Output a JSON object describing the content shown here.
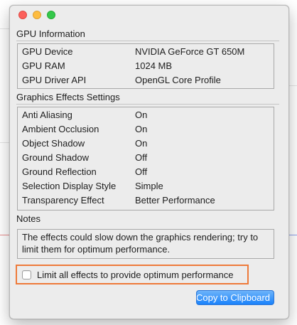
{
  "gpu_information": {
    "title": "GPU Information",
    "rows": [
      {
        "label": "GPU Device",
        "value": "NVIDIA GeForce GT 650M"
      },
      {
        "label": "GPU RAM",
        "value": "1024 MB"
      },
      {
        "label": "GPU Driver API",
        "value": "OpenGL Core Profile"
      }
    ]
  },
  "graphics_effects": {
    "title": "Graphics Effects Settings",
    "rows": [
      {
        "label": "Anti Aliasing",
        "value": "On"
      },
      {
        "label": "Ambient Occlusion",
        "value": "On"
      },
      {
        "label": "Object Shadow",
        "value": "On"
      },
      {
        "label": "Ground Shadow",
        "value": "Off"
      },
      {
        "label": "Ground Reflection",
        "value": "Off"
      },
      {
        "label": "Selection Display Style",
        "value": "Simple"
      },
      {
        "label": "Transparency Effect",
        "value": "Better Performance"
      }
    ]
  },
  "notes": {
    "title": "Notes",
    "text": "The effects could slow down the graphics rendering; try to limit them for optimum performance."
  },
  "limit_effects": {
    "label": "Limit all effects to provide optimum performance",
    "checked": false,
    "highlight_color": "#ee7a3a"
  },
  "copy_button": {
    "label": "Copy to Clipboard"
  },
  "window_controls": [
    "close-icon",
    "minimize-icon",
    "zoom-icon"
  ]
}
